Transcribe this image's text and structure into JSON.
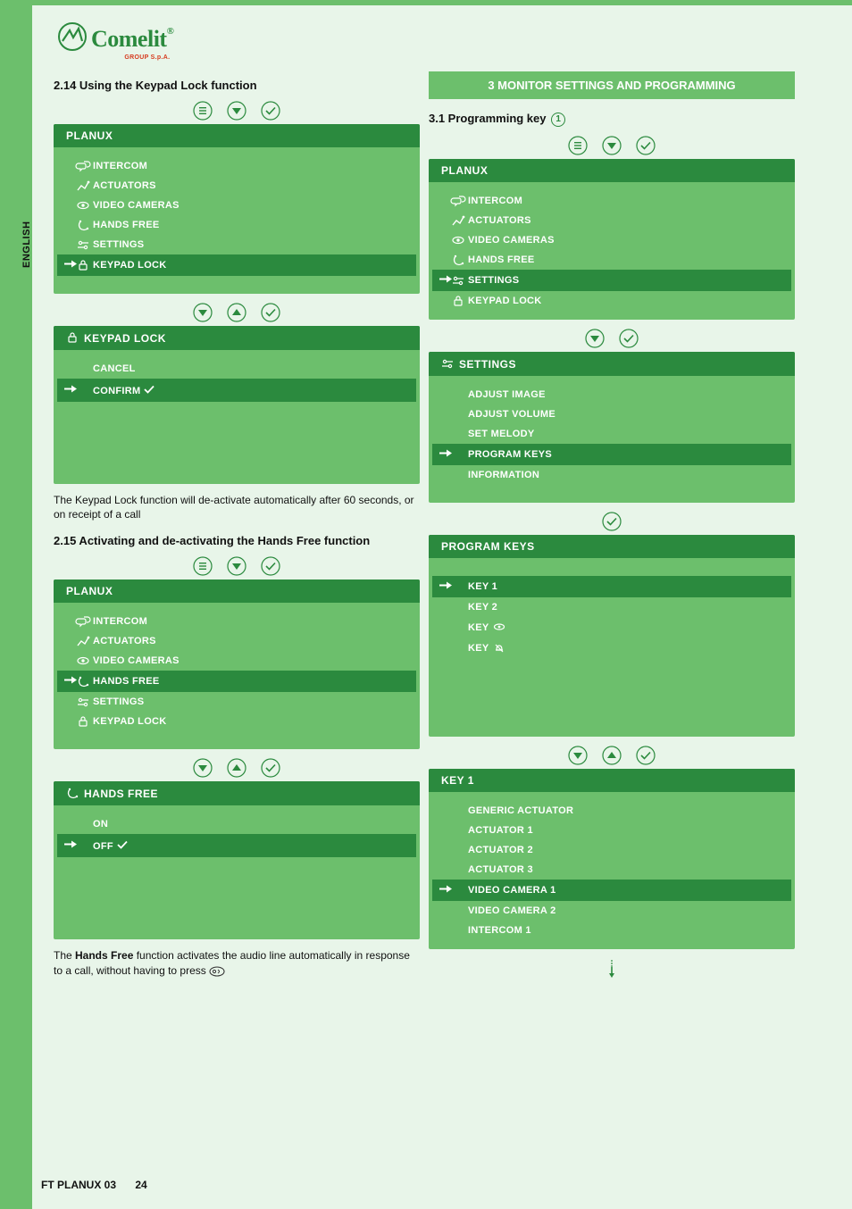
{
  "brand": {
    "name": "Comelit",
    "sub": "GROUP S.p.A.",
    "reg": "®"
  },
  "language_tab": "ENGLISH",
  "footer": {
    "doc": "FT PLANUX 03",
    "page": "24"
  },
  "icons": {
    "menu": "menu-icon",
    "down": "down-icon",
    "up": "up-icon",
    "confirm": "confirm-icon",
    "intercom": "intercom-icon",
    "actuators": "actuators-icon",
    "camera": "camera-icon",
    "handsfree": "handsfree-icon",
    "settings": "settings-icon",
    "lock": "lock-icon",
    "eye": "eye-icon",
    "bell": "bell-icon",
    "speak": "speak-icon",
    "arrow": "arrow-right-icon",
    "check": "check-icon",
    "continue": "continue-down-icon"
  },
  "left": {
    "s214_title": "2.14 Using the Keypad Lock function",
    "planux": "PLANUX",
    "menu_items": {
      "intercom": "INTERCOM",
      "actuators": "ACTUATORS",
      "video_cameras": "VIDEO CAMERAS",
      "hands_free": "HANDS FREE",
      "settings": "SETTINGS",
      "keypad_lock": "KEYPAD LOCK"
    },
    "keypad_lock_hdr": "KEYPAD LOCK",
    "keypad_lock_opts": {
      "cancel": "CANCEL",
      "confirm": "CONFIRM"
    },
    "note_214": "The Keypad Lock function will de-activate automatically after 60 seconds, or on receipt of a call",
    "s215_title": "2.15 Activating and de-activating the Hands Free function",
    "hands_free_hdr": "HANDS FREE",
    "hands_free_opts": {
      "on": "ON",
      "off": "OFF"
    },
    "note_215_a": "The ",
    "note_215_b": "Hands Free",
    "note_215_c": " function activates the audio line automatically in response to a call, without having to press "
  },
  "right": {
    "section3_title": "3 MONITOR SETTINGS AND PROGRAMMING",
    "s31_title": "3.1 Programming key ",
    "s31_key": "1",
    "planux": "PLANUX",
    "menu_items": {
      "intercom": "INTERCOM",
      "actuators": "ACTUATORS",
      "video_cameras": "VIDEO CAMERAS",
      "hands_free": "HANDS FREE",
      "settings": "SETTINGS",
      "keypad_lock": "KEYPAD LOCK"
    },
    "settings_hdr": "SETTINGS",
    "settings_items": {
      "adjust_image": "ADJUST IMAGE",
      "adjust_volume": "ADJUST VOLUME",
      "set_melody": "SET MELODY",
      "program_keys": "PROGRAM KEYS",
      "information": "INFORMATION"
    },
    "program_keys_hdr": "PROGRAM KEYS",
    "program_keys_items": {
      "key1": "KEY 1",
      "key2": "KEY 2",
      "key_eye": "KEY ",
      "key_bell": "KEY "
    },
    "key1_hdr": "KEY 1",
    "key1_items": {
      "generic_actuator": "GENERIC ACTUATOR",
      "actuator1": "ACTUATOR 1",
      "actuator2": "ACTUATOR 2",
      "actuator3": "ACTUATOR 3",
      "video_camera1": "VIDEO CAMERA 1",
      "video_camera2": "VIDEO CAMERA 2",
      "intercom1": "INTERCOM 1"
    }
  }
}
